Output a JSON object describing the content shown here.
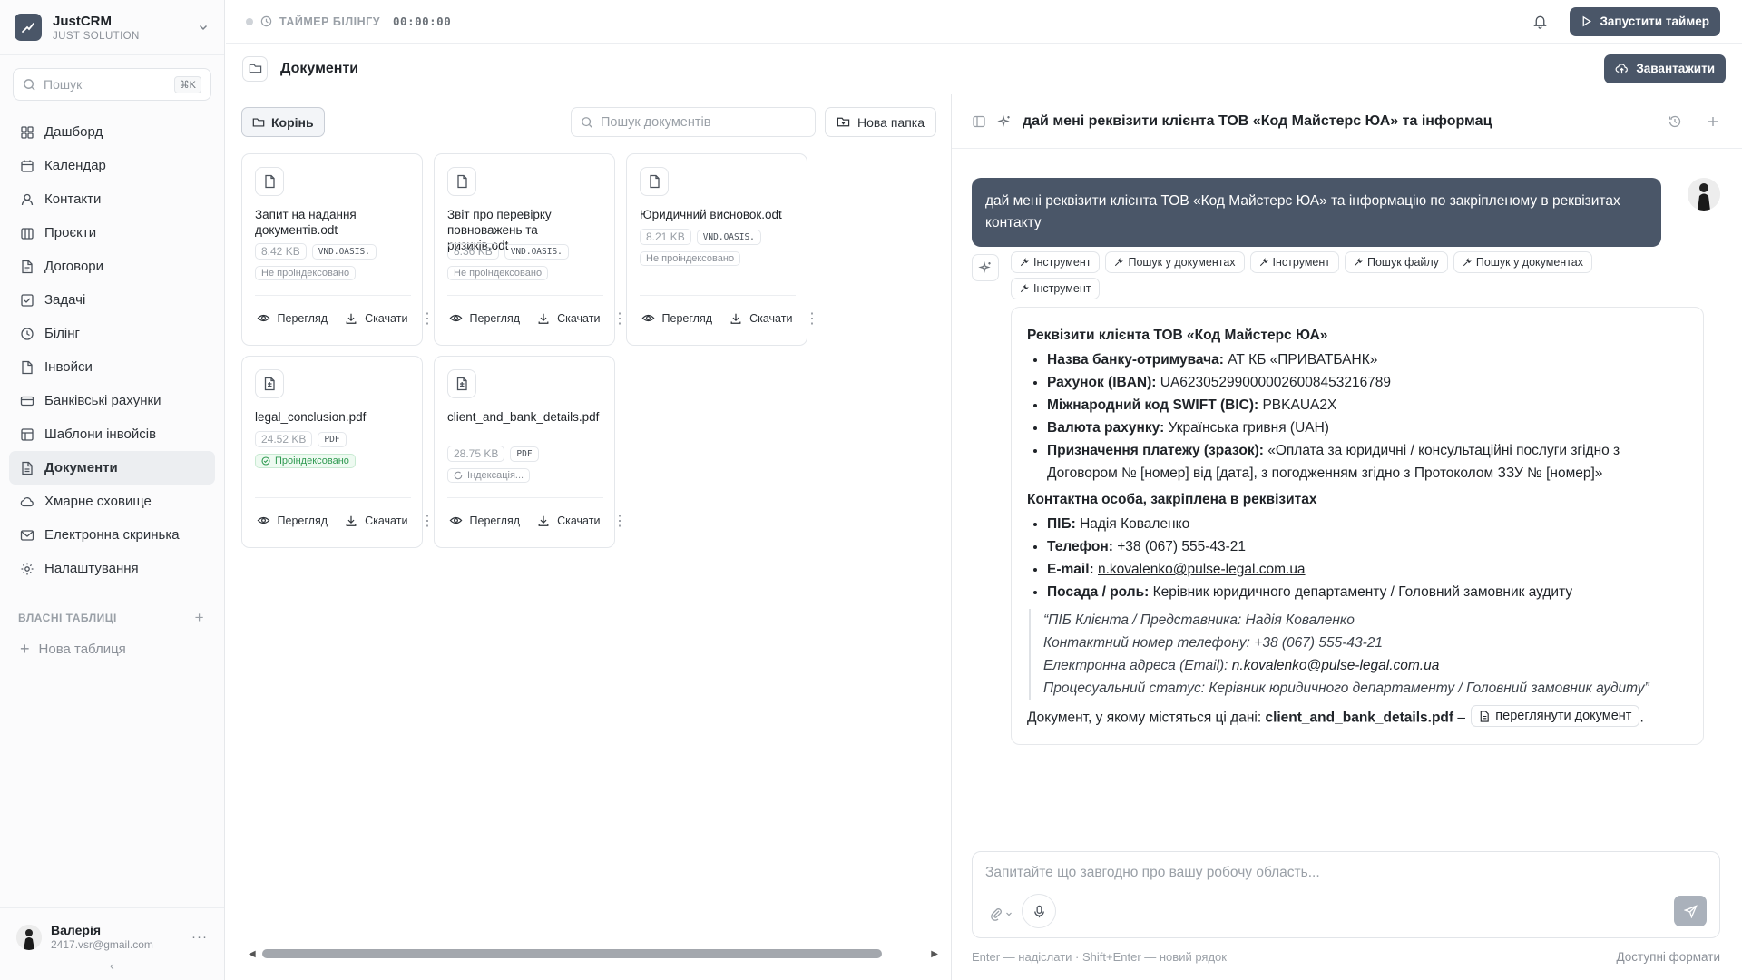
{
  "brand": {
    "name": "JustCRM",
    "sub": "JUST SOLUTION"
  },
  "sidebar": {
    "search_placeholder": "Пошук",
    "search_kbd": "⌘K",
    "items": [
      {
        "label": "Дашборд",
        "icon": "dashboard-icon"
      },
      {
        "label": "Календар",
        "icon": "calendar-icon"
      },
      {
        "label": "Контакти",
        "icon": "contacts-icon"
      },
      {
        "label": "Проєкти",
        "icon": "projects-icon"
      },
      {
        "label": "Договори",
        "icon": "contracts-icon"
      },
      {
        "label": "Задачі",
        "icon": "tasks-icon"
      },
      {
        "label": "Білінг",
        "icon": "billing-icon"
      },
      {
        "label": "Інвойси",
        "icon": "invoices-icon"
      },
      {
        "label": "Банківські рахунки",
        "icon": "bank-icon"
      },
      {
        "label": "Шаблони інвойсів",
        "icon": "templates-icon"
      },
      {
        "label": "Документи",
        "icon": "documents-icon"
      },
      {
        "label": "Хмарне сховище",
        "icon": "cloud-icon"
      },
      {
        "label": "Електронна скринька",
        "icon": "mail-icon"
      },
      {
        "label": "Налаштування",
        "icon": "settings-icon"
      }
    ],
    "active_index": 10,
    "section_title": "ВЛАСНІ ТАБЛИЦІ",
    "new_table": "Нова таблиця"
  },
  "user": {
    "name": "Валерія",
    "email": "2417.vsr@gmail.com"
  },
  "topbar": {
    "timer_label": "ТАЙМЕР БІЛІНГУ",
    "timer_value": "00:00:00",
    "start_timer": "Запустити таймер"
  },
  "page": {
    "title": "Документи",
    "upload": "Завантажити"
  },
  "docs": {
    "root": "Корінь",
    "search_placeholder": "Пошук документів",
    "new_folder": "Нова папка",
    "view_label": "Перегляд",
    "download_label": "Скачати",
    "files": [
      {
        "name": "Запит на надання документів.odt",
        "size": "8.42 KB",
        "type": "VND.OASIS.",
        "status": "Не проіндексовано",
        "state": "none"
      },
      {
        "name": "Звіт про перевірку повноважень та ризиків.odt",
        "size": "8.36 KB",
        "type": "VND.OASIS.",
        "status": "Не проіндексовано",
        "state": "none"
      },
      {
        "name": "Юридичний висновок.odt",
        "size": "8.21 KB",
        "type": "VND.OASIS.",
        "status": "Не проіндексовано",
        "state": "none"
      },
      {
        "name": "legal_conclusion.pdf",
        "size": "24.52 KB",
        "type": "PDF",
        "status": "Проіндексовано",
        "state": "ok"
      },
      {
        "name": "client_and_bank_details.pdf",
        "size": "28.75 KB",
        "type": "PDF",
        "status": "Індексація...",
        "state": "loading"
      }
    ]
  },
  "chat": {
    "title": "дай мені реквізити клієнта ТОВ «Код Майстерс ЮА» та інформац",
    "user_message": "дай мені реквізити клієнта ТОВ «Код Майстерс ЮА» та інформацію по закріпленому в реквізитах контакту",
    "tools": [
      "Інструмент",
      "Пошук у документах",
      "Інструмент",
      "Пошук файлу",
      "Пошук у документах",
      "Інструмент"
    ],
    "answer": {
      "heading1": "Реквізити клієнта ТОВ «Код Майстерс ЮА»",
      "bank_items": [
        {
          "k": "Назва банку-отримувача:",
          "v": "АТ КБ «ПРИВАТБАНК»"
        },
        {
          "k": "Рахунок (IBAN):",
          "v": "UA623052990000026008453216789"
        },
        {
          "k": "Міжнародний код SWIFT (BIC):",
          "v": "PBKAUA2X"
        },
        {
          "k": "Валюта рахунку:",
          "v": "Українська гривня (UAH)"
        },
        {
          "k": "Призначення платежу (зразок):",
          "v": "«Оплата за юридичні / консультаційні послуги згідно з Договором № [номер] від [дата], з погодженням згідно з Протоколом ЗЗУ № [номер]»"
        }
      ],
      "heading2": "Контактна особа, закріплена в реквізитах",
      "contact_items": [
        {
          "k": "ПІБ:",
          "v": "Надія Коваленко"
        },
        {
          "k": "Телефон:",
          "v": "+38 (067) 555-43-21"
        },
        {
          "k": "E-mail:",
          "v": "n.kovalenko@pulse-legal.com.ua"
        },
        {
          "k": "Посада / роль:",
          "v": "Керівник юридичного департаменту / Головний замовник аудиту"
        }
      ],
      "quote_lines": [
        "“ПІБ Клієнта / Представника: Надія Коваленко",
        "Контактний номер телефону: +38 (067) 555-43-21",
        "Електронна адреса (Email): ",
        "Процесуальний статус: Керівник юридичного департаменту / Головний замовник аудиту”"
      ],
      "quote_email": "n.kovalenko@pulse-legal.com.ua",
      "doc_prefix": "Документ, у якому містяться ці дані:",
      "doc_name": "client_and_bank_details.pdf",
      "doc_dash": "–",
      "doc_link": "переглянути документ",
      "doc_end": "."
    },
    "input_placeholder": "Запитайте що завгодно про вашу робочу область...",
    "hint": "Enter — надіслати · Shift+Enter — новий рядок",
    "formats": "Доступні формати"
  }
}
